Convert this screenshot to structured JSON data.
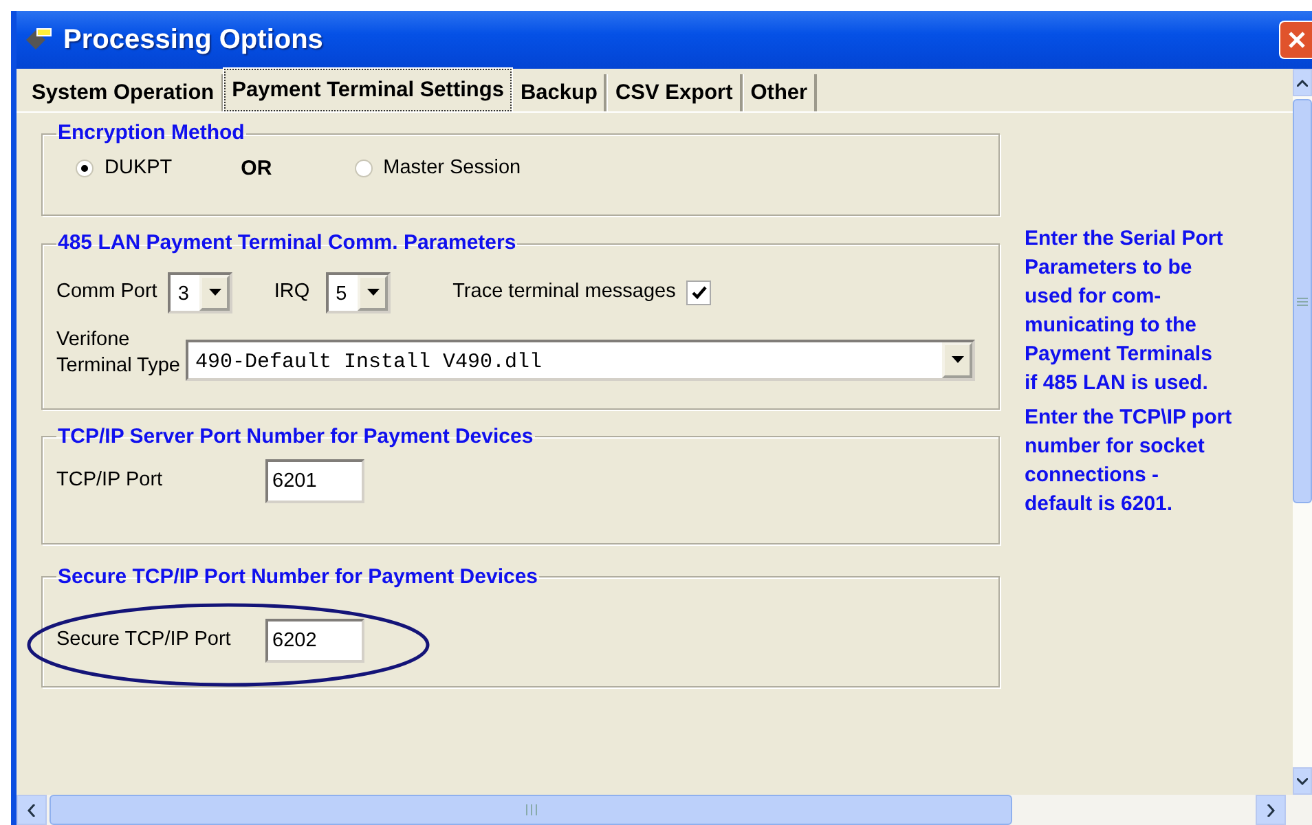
{
  "window": {
    "title": "Processing Options"
  },
  "tabs": [
    {
      "label": "System Operation",
      "selected": false
    },
    {
      "label": "Payment Terminal Settings",
      "selected": true
    },
    {
      "label": "Backup",
      "selected": false
    },
    {
      "label": "CSV Export",
      "selected": false
    },
    {
      "label": "Other",
      "selected": false
    }
  ],
  "encryption": {
    "title": "Encryption Method",
    "separator": "OR",
    "options": [
      {
        "label": "DUKPT",
        "selected": true
      },
      {
        "label": "Master Session",
        "selected": false
      }
    ]
  },
  "lan": {
    "title": "485 LAN Payment Terminal Comm. Parameters",
    "comm_port": {
      "label": "Comm Port",
      "value": "3"
    },
    "irq": {
      "label": "IRQ",
      "value": "5"
    },
    "trace": {
      "label": "Trace terminal messages",
      "checked": true
    },
    "terminal_type": {
      "label": "Verifone\nTerminal Type",
      "value": "490-Default Install V490.dll"
    }
  },
  "tcp": {
    "title": "TCP/IP Server Port Number for Payment Devices",
    "label": "TCP/IP Port",
    "value": "6201"
  },
  "secure": {
    "title": "Secure TCP/IP Port Number for Payment Devices",
    "label": "Secure TCP/IP Port",
    "value": "6202",
    "highlighted": true
  },
  "help": [
    "Enter the Serial Port\nParameters to be\nused for com-\nmunicating to the\nPayment Terminals\nif 485 LAN is used.",
    "Enter the TCP\\IP port\nnumber for socket\nconnections -\ndefault is 6201."
  ]
}
